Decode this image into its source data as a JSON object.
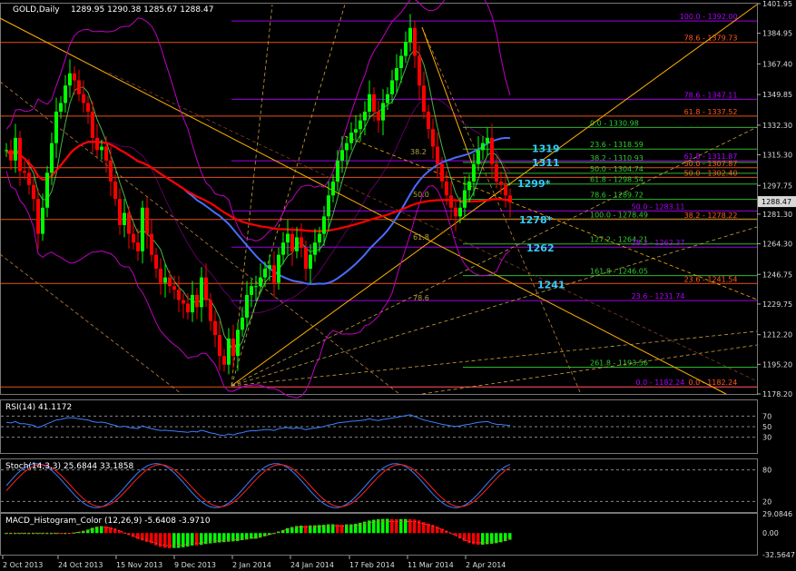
{
  "chart_data": {
    "type": "candlestick",
    "title": "GOLD,Daily",
    "ohlc_header": "1289.95 1290.38 1285.67 1288.47",
    "last_price": "1288.47",
    "y_ticks": [
      "1401.95",
      "1384.95",
      "1367.40",
      "1349.85",
      "1332.30",
      "1315.30",
      "1297.75",
      "1281.30",
      "1264.30",
      "1246.75",
      "1229.75",
      "1212.20",
      "1195.20",
      "1178.20"
    ],
    "ylim": [
      1178.2,
      1401.95
    ],
    "x_ticks": [
      "2 Oct 2013",
      "24 Oct 2013",
      "15 Nov 2013",
      "9 Dec 2013",
      "2 Jan 2014",
      "24 Jan 2014",
      "17 Feb 2014",
      "11 Mar 2014",
      "2 Apr 2014"
    ],
    "closes": [
      1318,
      1312,
      1325,
      1306,
      1305,
      1298,
      1290,
      1270,
      1285,
      1305,
      1322,
      1340,
      1345,
      1355,
      1362,
      1358,
      1350,
      1345,
      1340,
      1325,
      1318,
      1320,
      1312,
      1300,
      1290,
      1275,
      1282,
      1270,
      1265,
      1260,
      1285,
      1270,
      1258,
      1250,
      1242,
      1245,
      1240,
      1238,
      1232,
      1230,
      1225,
      1235,
      1228,
      1245,
      1232,
      1220,
      1212,
      1200,
      1195,
      1210,
      1200,
      1215,
      1222,
      1235,
      1240,
      1240,
      1245,
      1250,
      1252,
      1242,
      1258,
      1265,
      1270,
      1260,
      1268,
      1262,
      1250,
      1258,
      1265,
      1270,
      1280,
      1292,
      1300,
      1312,
      1318,
      1322,
      1328,
      1330,
      1335,
      1340,
      1350,
      1340,
      1335,
      1345,
      1350,
      1358,
      1365,
      1372,
      1380,
      1388,
      1372,
      1355,
      1340,
      1330,
      1320,
      1310,
      1300,
      1292,
      1285,
      1280,
      1285,
      1295,
      1300,
      1310,
      1318,
      1322,
      1325,
      1310,
      1300,
      1298,
      1292,
      1288
    ],
    "fib_levels": [
      {
        "label": "100.0  -  1392.00",
        "value": 1392.0,
        "color": "#b000ff"
      },
      {
        "label": "78.6  -  1379.73",
        "value": 1379.73,
        "color": "#ff5a1e"
      },
      {
        "label": "78.6  -  1347.11",
        "value": 1347.11,
        "color": "#b000ff"
      },
      {
        "label": "61.8  -  1337.52",
        "value": 1337.52,
        "color": "#ff5a1e"
      },
      {
        "label": "0.0  -  1330.98",
        "value": 1330.98,
        "color": "#33cc33"
      },
      {
        "label": "23.6  -  1318.59",
        "value": 1318.59,
        "color": "#33cc33"
      },
      {
        "label": "38.2  -  1310.93",
        "value": 1310.93,
        "color": "#33cc33"
      },
      {
        "label": "61.8  -  1311.87",
        "value": 1311.87,
        "color": "#b000ff"
      },
      {
        "label": "50.0  -  1307.87",
        "value": 1307.87,
        "color": "#ff5a1e"
      },
      {
        "label": "50.0  -  1304.74",
        "value": 1304.74,
        "color": "#33cc33"
      },
      {
        "label": "50.0  -  1302.40",
        "value": 1302.4,
        "color": "#ff5a1e"
      },
      {
        "label": "61.8  -  1298.54",
        "value": 1298.54,
        "color": "#33cc33"
      },
      {
        "label": "78.6  -  1289.72",
        "value": 1289.72,
        "color": "#33cc33"
      },
      {
        "label": "50.0  -  1283.11",
        "value": 1283.11,
        "color": "#b000ff"
      },
      {
        "label": "100.0  -  1278.49",
        "value": 1278.49,
        "color": "#33cc33"
      },
      {
        "label": "38.2  -  1278.22",
        "value": 1278.22,
        "color": "#ff5a1e"
      },
      {
        "label": "127.2  -  1264.21",
        "value": 1264.21,
        "color": "#33cc33"
      },
      {
        "label": "38.2  -  1262.37",
        "value": 1262.37,
        "color": "#b000ff"
      },
      {
        "label": "161.8  -  1246.05",
        "value": 1246.05,
        "color": "#33cc33"
      },
      {
        "label": "23.6  -  1241.54",
        "value": 1241.54,
        "color": "#ff5a1e"
      },
      {
        "label": "23.6  -  1231.74",
        "value": 1231.74,
        "color": "#b000ff"
      },
      {
        "label": "261.8  -  1193.56",
        "value": 1193.56,
        "color": "#33cc33"
      },
      {
        "label": "0.0  -  1182.24",
        "value": 1182.24,
        "color": "#b000ff"
      },
      {
        "label": "0.0  -  1182.24",
        "value": 1182.24,
        "color": "#ff5a1e"
      }
    ],
    "price_labels": [
      {
        "text": "1319",
        "value": 1319
      },
      {
        "text": "1311",
        "value": 1311
      },
      {
        "text": "1299*",
        "value": 1299
      },
      {
        "text": "1278*",
        "value": 1278
      },
      {
        "text": "1262",
        "value": 1262
      },
      {
        "text": "1241",
        "value": 1241
      }
    ],
    "inner_fib_labels": [
      "38.2",
      "50.0",
      "61.8",
      "78.6"
    ],
    "rsi": {
      "label": "RSI(14) 41.1172",
      "ticks": [
        "70",
        "50",
        "30"
      ],
      "levels": [
        70,
        50,
        30
      ]
    },
    "stoch": {
      "label": "Stoch(14,3,3) 25.6844 33.1858",
      "ticks": [
        "80",
        "20"
      ],
      "levels": [
        80,
        20
      ]
    },
    "macd": {
      "label": "MACD_Histogram_Color (12,26,9) -5.6408 -3.9710",
      "ticks": [
        "29.0846",
        "0.00",
        "-32.5647"
      ]
    },
    "colors": {
      "bull": "#00ff00",
      "bear": "#ff0000",
      "ma_red": "#ff0000",
      "ma_blue": "#4a6cff",
      "bollinger": "#c000c0",
      "green_ma": "#66ff66",
      "grid": "#2a2a2a"
    }
  }
}
